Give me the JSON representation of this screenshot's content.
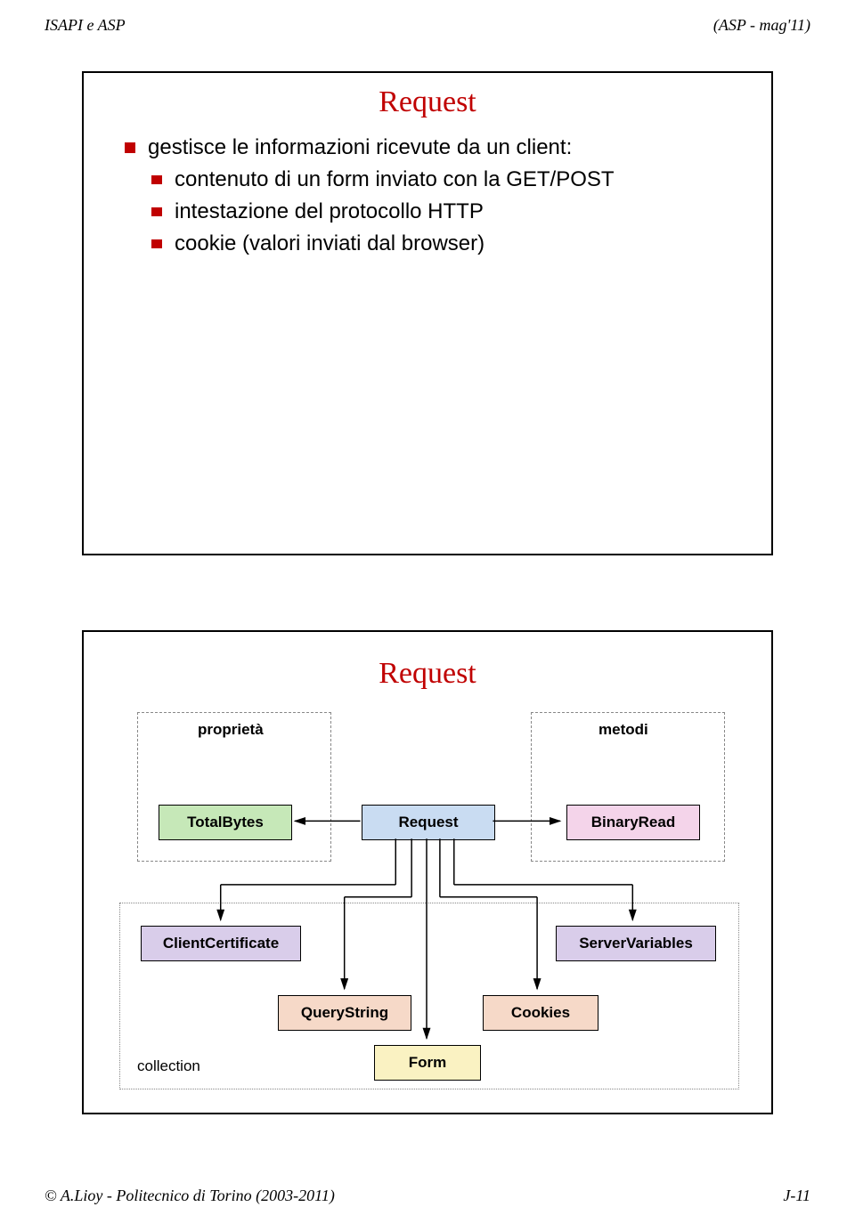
{
  "header": {
    "left": "ISAPI e ASP",
    "right": "(ASP - mag'11)"
  },
  "footer": {
    "left": "© A.Lioy - Politecnico di Torino (2003-2011)",
    "right": "J-11"
  },
  "slide1": {
    "title": "Request",
    "line_main": "gestisce le informazioni ricevute da un client:",
    "sub1": "contenuto di un form inviato con la GET/POST",
    "sub2": "intestazione del protocollo HTTP",
    "sub3": "cookie (valori inviati dal browser)"
  },
  "slide2": {
    "title": "Request",
    "label_proprieta": "proprietà",
    "label_metodi": "metodi",
    "label_collection": "collection",
    "node_totalbytes": "TotalBytes",
    "node_request": "Request",
    "node_binaryread": "BinaryRead",
    "node_clientcert": "ClientCertificate",
    "node_servervars": "ServerVariables",
    "node_querystring": "QueryString",
    "node_cookies": "Cookies",
    "node_form": "Form"
  }
}
